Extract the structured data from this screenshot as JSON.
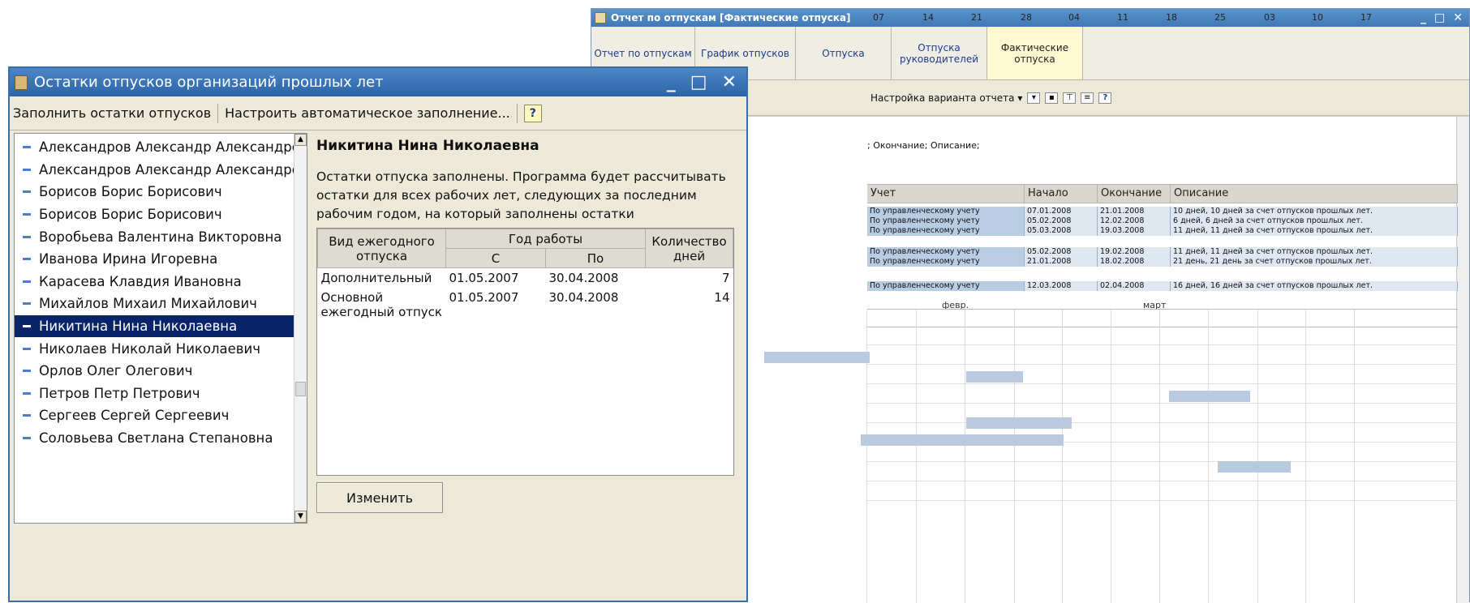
{
  "report_window": {
    "title": "Отчет по отпускам [Фактические отпуска]",
    "tabs": [
      "Отчет по отпускам",
      "График отпусков",
      "Отпуска",
      "Отпуска\nруководителей",
      "Фактические\nотпуска"
    ],
    "toolbar_label": "Настройка варианта отчета",
    "params_text": "; Окончание; Описание;",
    "columns": [
      "Учет",
      "Начало",
      "Окончание",
      "Описание"
    ],
    "rows": [
      {
        "acc": "По управленческому учету",
        "start": "07.01.2008",
        "end": "21.01.2008",
        "desc": "10 дней, 10 дней за счет отпусков прошлых лет."
      },
      {
        "acc": "По управленческому учету",
        "start": "05.02.2008",
        "end": "12.02.2008",
        "desc": "6 дней, 6 дней за счет отпусков прошлых лет."
      },
      {
        "acc": "По управленческому учету",
        "start": "05.03.2008",
        "end": "19.03.2008",
        "desc": "11 дней, 11 дней за счет отпусков прошлых лет."
      },
      {
        "acc": "По управленческому учету",
        "start": "05.02.2008",
        "end": "19.02.2008",
        "desc": "11 дней, 11 дней за счет отпусков прошлых лет."
      },
      {
        "acc": "По управленческому учету",
        "start": "21.01.2008",
        "end": "18.02.2008",
        "desc": "21 день, 21 день за счет отпусков прошлых лет."
      },
      {
        "acc": "По управленческому учету",
        "start": "12.03.2008",
        "end": "02.04.2008",
        "desc": "16 дней, 16 дней за счет отпусков прошлых лет."
      }
    ],
    "gantt": {
      "months": [
        "февр.",
        "март"
      ],
      "days": [
        "07",
        "14",
        "21",
        "28",
        "04",
        "11",
        "18",
        "25",
        "03",
        "10",
        "17"
      ]
    }
  },
  "dialog": {
    "title": "Остатки отпусков организаций прошлых лет",
    "toolbar": {
      "fill_label": "Заполнить остатки отпусков",
      "auto_label": "Настроить автоматическое заполнение...",
      "help_label": "?"
    },
    "employees": [
      "Александров Александр Александро...",
      "Александров Александр Александро...",
      "Борисов Борис Борисович",
      "Борисов Борис Борисович",
      "Воробьева Валентина Викторовна",
      "Иванова Ирина Игоревна",
      "Карасева Клавдия Ивановна",
      "Михайлов Михаил Михайлович",
      "Никитина Нина  Николаевна",
      "Николаев Николай Николаевич",
      "Орлов  Олег  Олегович",
      "Петров Петр Петрович",
      "Сергеев Сергей Сергеевич",
      "Соловьева Светлана Степановна"
    ],
    "selected_name": "Никитина Нина  Николаевна",
    "description": "Остатки отпуска заполнены. Программа будет рассчитывать остатки для всех рабочих лет, следующих за последним рабочим годом, на который заполнены остатки",
    "table": {
      "h_type": "Вид ежегодного отпуска",
      "h_year": "Год работы",
      "h_from": "С",
      "h_to": "По",
      "h_days": "Количество дней",
      "rows": [
        {
          "type": "Дополнительный",
          "from": "01.05.2007",
          "to": "30.04.2008",
          "days": "7"
        },
        {
          "type": "Основной ежегодный отпуск",
          "from": "01.05.2007",
          "to": "30.04.2008",
          "days": "14"
        }
      ]
    },
    "change_label": "Изменить"
  }
}
